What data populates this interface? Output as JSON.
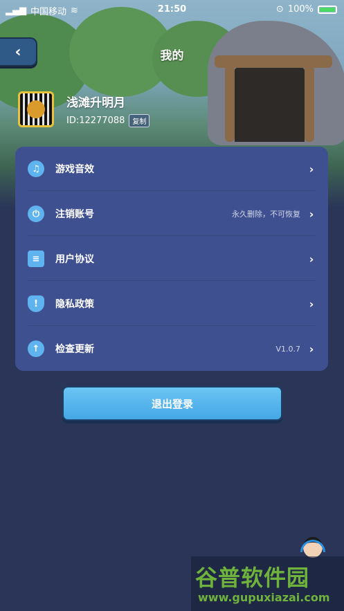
{
  "status_bar": {
    "carrier": "中国移动",
    "time": "21:50",
    "battery": "100%"
  },
  "header": {
    "back_symbol": "‹",
    "title": "我的"
  },
  "profile": {
    "nickname": "浅滩升明月",
    "user_id": "ID:12277088",
    "copy_label": "复制"
  },
  "menu": {
    "items": [
      {
        "label": "游戏音效",
        "value": "",
        "icon": "music-icon"
      },
      {
        "label": "注销账号",
        "value": "永久删除，不可恢复",
        "icon": "power-icon"
      },
      {
        "label": "用户协议",
        "value": "",
        "icon": "document-icon"
      },
      {
        "label": "隐私政策",
        "value": "",
        "icon": "shield-icon"
      },
      {
        "label": "检查更新",
        "value": "V1.0.7",
        "icon": "arrow-up-icon"
      }
    ],
    "chevron": "›"
  },
  "logout_label": "退出登录",
  "watermark": {
    "main": "谷普软件园",
    "sub": "www.gupuxiazai.com"
  },
  "colors": {
    "background": "#2a3558",
    "card": "#3f5090",
    "accent": "#5fb3ee",
    "button": "#45a7e6"
  }
}
